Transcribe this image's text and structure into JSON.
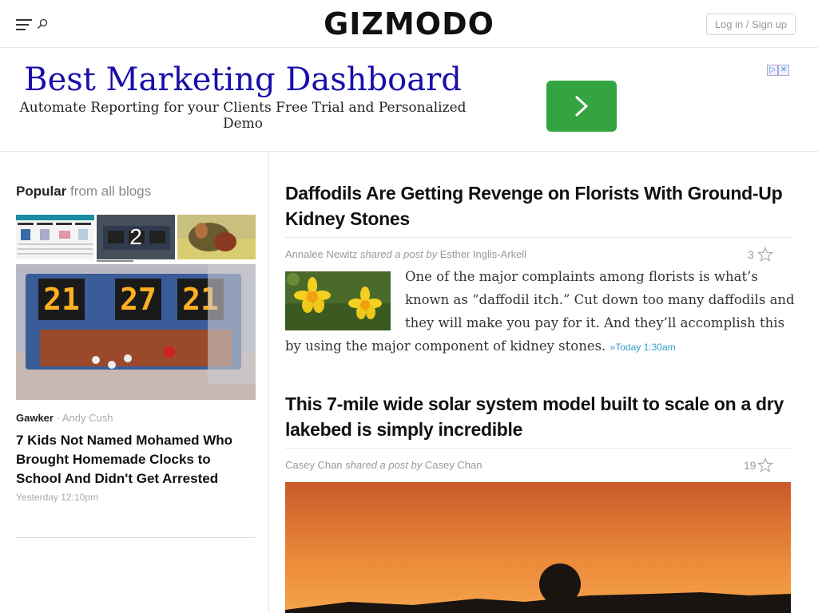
{
  "header": {
    "logo": "GIZMODO",
    "login_label": "Log in / Sign up"
  },
  "ad": {
    "title": "Best Marketing Dashboard",
    "subtitle": "Automate Reporting for your Clients Free Trial and Personalized Demo",
    "button_color": "#34a441"
  },
  "sidebar": {
    "popular_label": "Popular",
    "popular_suffix": "from all blogs",
    "thumb_2_number": "2",
    "blog": "Gawker",
    "author": "Andy Cush",
    "headline": "7 Kids Not Named Mohamed Who Brought Homemade Clocks to School And Didn't Get Arrested",
    "time": "Yesterday 12:10pm"
  },
  "posts": [
    {
      "title": "Daffodils Are Getting Revenge on Florists With Ground-Up Kidney Stones",
      "author": "Annalee Newitz",
      "shared_text": "shared a post by",
      "original_author": "Esther Inglis-Arkell",
      "count": "3",
      "excerpt": "One of the major complaints among florists is what’s known as “daffodil itch.” Cut down too many daffodils and they will make you pay for it. And they’ll accomplish this by using the major component of kidney stones.",
      "time_link": "»Today 1:30am"
    },
    {
      "title": "This 7-mile wide solar system model built to scale on a dry lakebed is simply incredible",
      "author": "Casey Chan",
      "shared_text": "shared a post by",
      "original_author": "Casey Chan",
      "count": "19"
    }
  ]
}
